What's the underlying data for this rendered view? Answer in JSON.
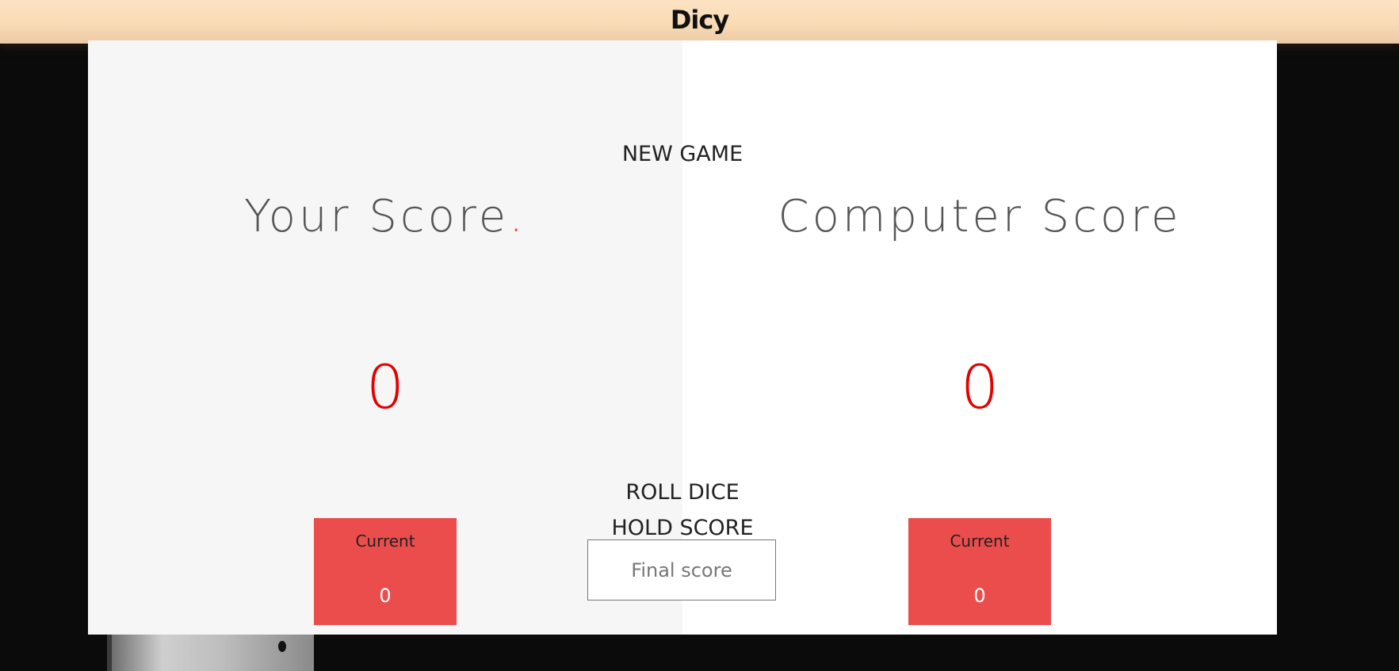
{
  "app": {
    "title": "Dicy"
  },
  "players": [
    {
      "name": "Your Score",
      "active_marker": ".",
      "score": "0",
      "current_label": "Current",
      "current_score": "0"
    },
    {
      "name": "Computer Score",
      "score": "0",
      "current_label": "Current",
      "current_score": "0"
    }
  ],
  "controls": {
    "new_game": "NEW GAME",
    "roll_dice": "ROLL DICE",
    "hold_score": "HOLD SCORE",
    "final_score_placeholder": "Final score"
  },
  "colors": {
    "accent": "#eb4d4d",
    "score": "#e30000",
    "header_bg": "#fde3c3",
    "left_panel": "#f6f6f6",
    "right_panel": "#ffffff",
    "page_bg": "#0b0b0b"
  }
}
